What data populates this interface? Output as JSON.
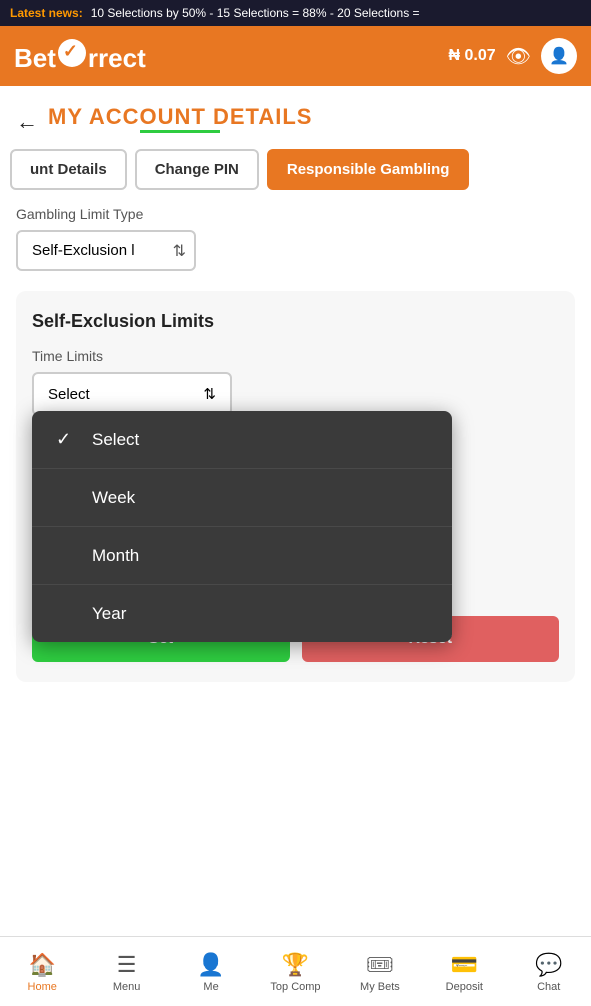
{
  "news": {
    "label": "Latest news:",
    "text": "10 Selections by 50% - 15 Selections = 88% - 20 Selections ="
  },
  "header": {
    "logo": "BetCorrect",
    "balance": "₦ 0.07"
  },
  "page": {
    "back_label": "←",
    "title": "MY ACCOUNT DETAILS"
  },
  "tabs": [
    {
      "id": "account-details",
      "label": "unt Details",
      "active": false
    },
    {
      "id": "change-pin",
      "label": "Change PIN",
      "active": false
    },
    {
      "id": "responsible-gambling",
      "label": "Responsible Gambling",
      "active": true
    }
  ],
  "gambling_limit": {
    "label": "Gambling Limit Type",
    "selected": "Self-Exclusion l"
  },
  "self_exclusion": {
    "title": "Self-Exclusion Limits",
    "time_limits_label": "Time Limits",
    "select_placeholder": "Select",
    "dropdown_items": [
      {
        "id": "select",
        "label": "Select",
        "checked": true
      },
      {
        "id": "week",
        "label": "Week",
        "checked": false
      },
      {
        "id": "month",
        "label": "Month",
        "checked": false
      },
      {
        "id": "year",
        "label": "Year",
        "checked": false
      }
    ],
    "btn_set": "Set",
    "btn_reset": "Reset"
  },
  "bottom_nav": [
    {
      "id": "home",
      "label": "Home",
      "icon": "🏠",
      "active": true
    },
    {
      "id": "menu",
      "label": "Menu",
      "icon": "☰",
      "active": false
    },
    {
      "id": "me",
      "label": "Me",
      "icon": "👤",
      "active": false
    },
    {
      "id": "top-comp",
      "label": "Top Comp",
      "icon": "🏆",
      "active": false
    },
    {
      "id": "my-bets",
      "label": "My Bets",
      "icon": "🎟",
      "active": false
    },
    {
      "id": "deposit",
      "label": "Deposit",
      "icon": "💳",
      "active": false
    },
    {
      "id": "chat",
      "label": "Chat",
      "icon": "💬",
      "active": false
    }
  ]
}
